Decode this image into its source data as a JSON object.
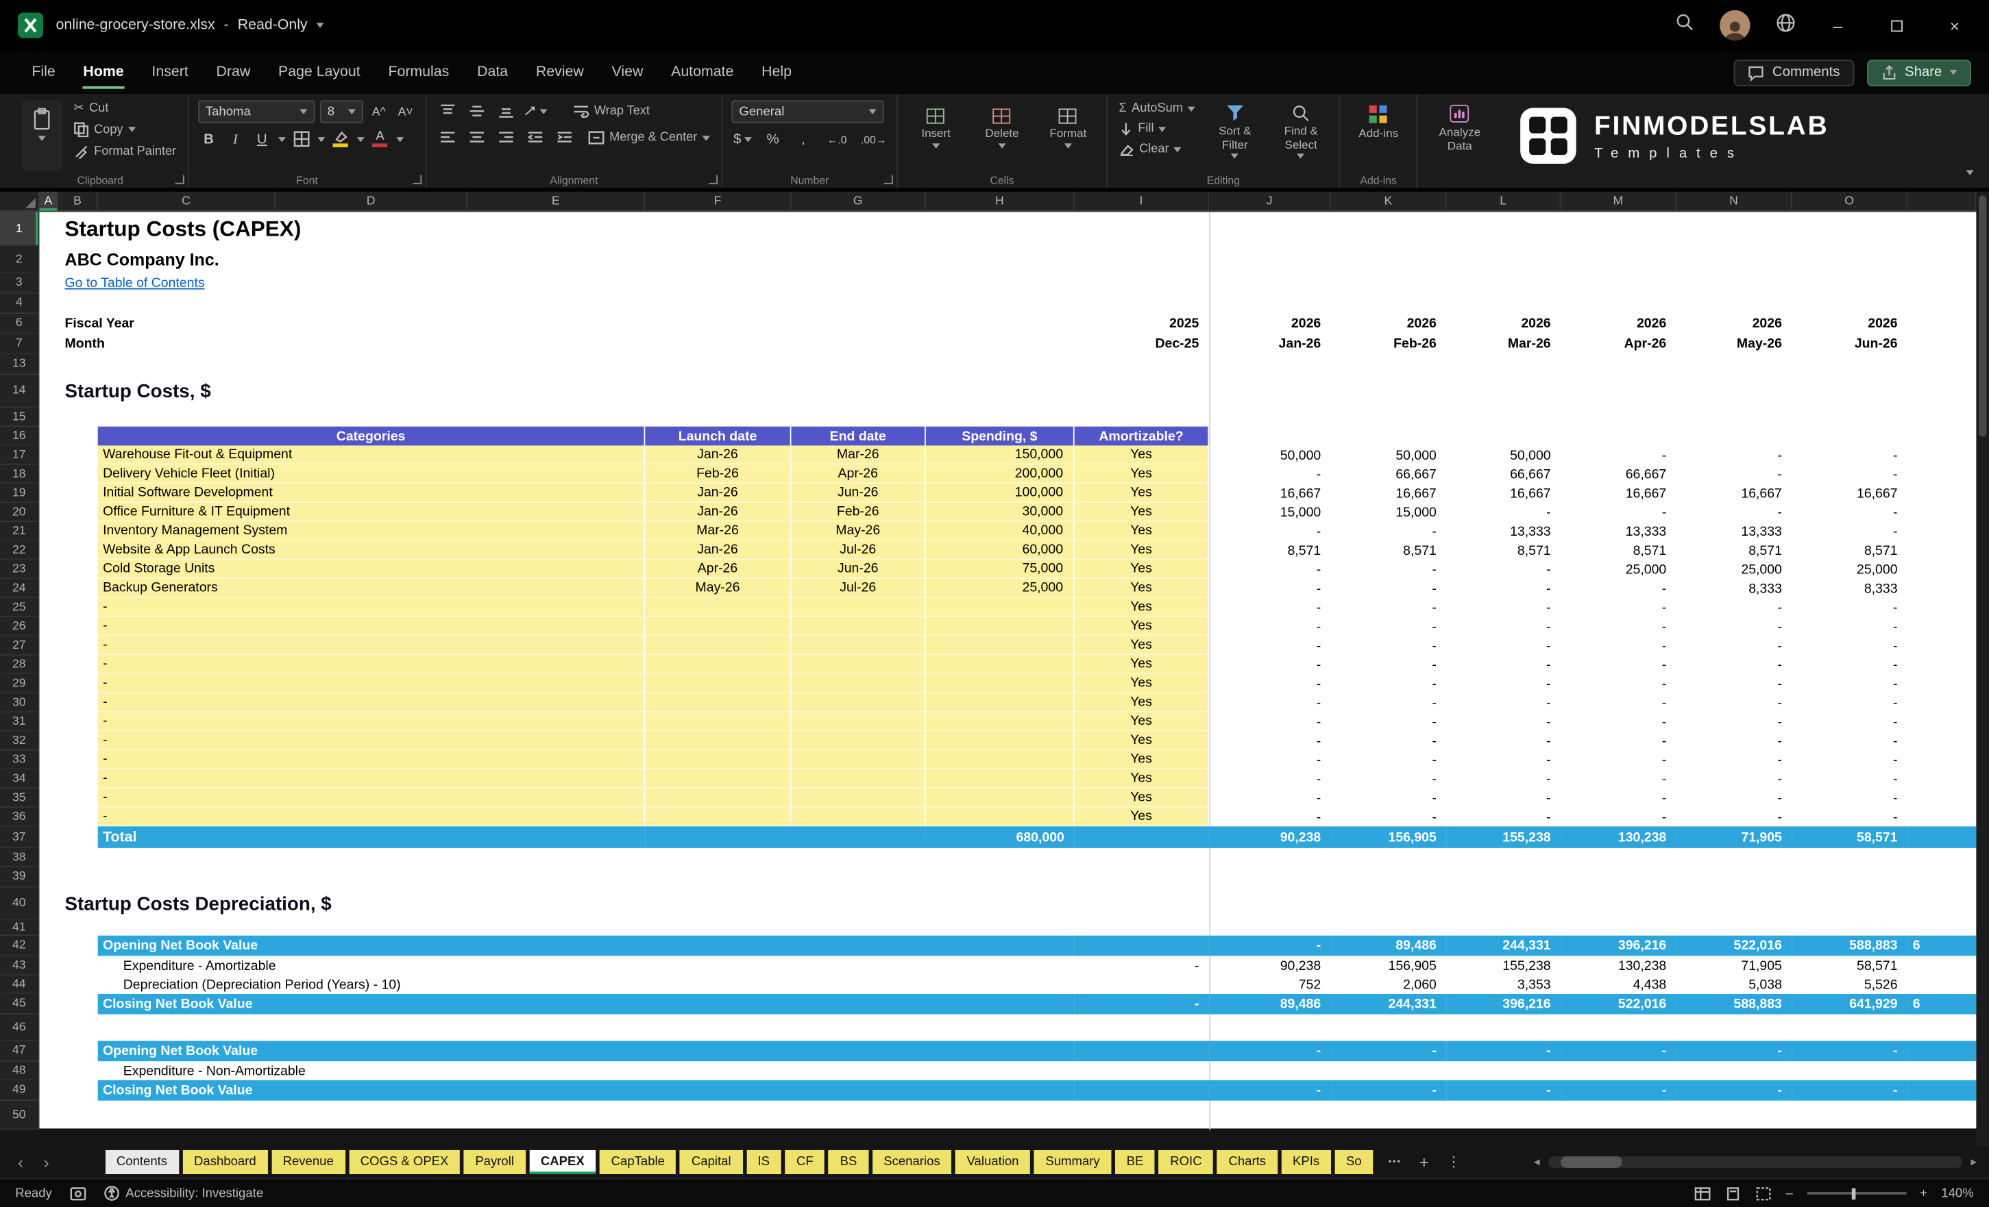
{
  "titlebar": {
    "filename": "online-grocery-store.xlsx",
    "separator": "-",
    "mode": "Read-Only",
    "window": {
      "minimize": "–",
      "close": "×"
    }
  },
  "menu": {
    "tabs": [
      "File",
      "Home",
      "Insert",
      "Draw",
      "Page Layout",
      "Formulas",
      "Data",
      "Review",
      "View",
      "Automate",
      "Help"
    ],
    "comments": "Comments",
    "share": "Share"
  },
  "ribbon": {
    "clipboard": {
      "label": "Clipboard",
      "cut": "Cut",
      "copy": "Copy",
      "format_painter": "Format Painter"
    },
    "font": {
      "label": "Font",
      "family": "Tahoma",
      "size": "8",
      "bold": "B",
      "italic": "I",
      "underline": "U",
      "grow": "A^",
      "shrink": "A˅"
    },
    "alignment": {
      "label": "Alignment",
      "wrap": "Wrap Text",
      "merge": "Merge & Center"
    },
    "number": {
      "label": "Number",
      "format": "General",
      "currency": "$",
      "percent": "%",
      "comma": ",",
      "inc_decimal": "←.0",
      "dec_decimal": ".00→"
    },
    "cells": {
      "label": "Cells",
      "insert": "Insert",
      "delete": "Delete",
      "format": "Format"
    },
    "editing": {
      "label": "Editing",
      "sigma": "Σ",
      "autosum": "AutoSum",
      "fill": "Fill",
      "clear": "Clear",
      "sort_filter": "Sort & Filter",
      "find_select": "Find & Select"
    },
    "addins": {
      "label": "Add-ins",
      "button": "Add-ins"
    },
    "analyze": {
      "label": "Analyze Data"
    },
    "brand": {
      "name": "FINMODELSLAB",
      "sub": "Templates"
    }
  },
  "grid": {
    "columns": [
      "A",
      "B",
      "C",
      "D",
      "E",
      "F",
      "G",
      "H",
      "I",
      "J",
      "K",
      "L",
      "M",
      "N",
      "O"
    ],
    "rownums": {
      "r1": "1",
      "r2": "2",
      "r3": "3",
      "r4": "4",
      "r6": "6",
      "r7": "7",
      "r13": "13",
      "r14": "14",
      "r15": "15",
      "r16": "16",
      "r37": "37",
      "r38": "38",
      "r39": "39",
      "r40": "40",
      "r41": "41",
      "r42": "42",
      "r43": "43",
      "r44": "44",
      "r45": "45",
      "r46": "46",
      "r47": "47",
      "r48": "48",
      "r49": "49",
      "r50": "50"
    }
  },
  "sheet": {
    "title": "Startup Costs (CAPEX)",
    "company": "ABC Company Inc.",
    "toc_link": "Go to Table of Contents",
    "fiscal": {
      "label": "Fiscal Year",
      "base": "2025",
      "years": [
        "2026",
        "2026",
        "2026",
        "2026",
        "2026",
        "2026"
      ]
    },
    "month": {
      "label": "Month",
      "base": "Dec-25",
      "months": [
        "Jan-26",
        "Feb-26",
        "Mar-26",
        "Apr-26",
        "May-26",
        "Jun-26"
      ]
    },
    "costs_heading": "Startup Costs, $",
    "table_headers": [
      "Categories",
      "Launch date",
      "End date",
      "Spending, $",
      "Amortizable?"
    ],
    "cost_rows": [
      {
        "n": "17",
        "category": "Warehouse Fit-out & Equipment",
        "launch": "Jan-26",
        "end": "Mar-26",
        "spend": "150,000",
        "amort": "Yes",
        "m": [
          "50,000",
          "50,000",
          "50,000",
          "-",
          "-",
          "-"
        ]
      },
      {
        "n": "18",
        "category": "Delivery Vehicle Fleet (Initial)",
        "launch": "Feb-26",
        "end": "Apr-26",
        "spend": "200,000",
        "amort": "Yes",
        "m": [
          "-",
          "66,667",
          "66,667",
          "66,667",
          "-",
          "-"
        ]
      },
      {
        "n": "19",
        "category": "Initial Software Development",
        "launch": "Jan-26",
        "end": "Jun-26",
        "spend": "100,000",
        "amort": "Yes",
        "m": [
          "16,667",
          "16,667",
          "16,667",
          "16,667",
          "16,667",
          "16,667"
        ]
      },
      {
        "n": "20",
        "category": "Office Furniture & IT Equipment",
        "launch": "Jan-26",
        "end": "Feb-26",
        "spend": "30,000",
        "amort": "Yes",
        "m": [
          "15,000",
          "15,000",
          "-",
          "-",
          "-",
          "-"
        ]
      },
      {
        "n": "21",
        "category": "Inventory Management System",
        "launch": "Mar-26",
        "end": "May-26",
        "spend": "40,000",
        "amort": "Yes",
        "m": [
          "-",
          "-",
          "13,333",
          "13,333",
          "13,333",
          "-"
        ]
      },
      {
        "n": "22",
        "category": "Website & App Launch Costs",
        "launch": "Jan-26",
        "end": "Jul-26",
        "spend": "60,000",
        "amort": "Yes",
        "m": [
          "8,571",
          "8,571",
          "8,571",
          "8,571",
          "8,571",
          "8,571"
        ]
      },
      {
        "n": "23",
        "category": "Cold Storage Units",
        "launch": "Apr-26",
        "end": "Jun-26",
        "spend": "75,000",
        "amort": "Yes",
        "m": [
          "-",
          "-",
          "-",
          "25,000",
          "25,000",
          "25,000"
        ]
      },
      {
        "n": "24",
        "category": "Backup Generators",
        "launch": "May-26",
        "end": "Jul-26",
        "spend": "25,000",
        "amort": "Yes",
        "m": [
          "-",
          "-",
          "-",
          "-",
          "8,333",
          "8,333"
        ]
      },
      {
        "n": "25",
        "category": "-",
        "launch": "",
        "end": "",
        "spend": "",
        "amort": "Yes",
        "m": [
          "-",
          "-",
          "-",
          "-",
          "-",
          "-"
        ]
      },
      {
        "n": "26",
        "category": "-",
        "launch": "",
        "end": "",
        "spend": "",
        "amort": "Yes",
        "m": [
          "-",
          "-",
          "-",
          "-",
          "-",
          "-"
        ]
      },
      {
        "n": "27",
        "category": "-",
        "launch": "",
        "end": "",
        "spend": "",
        "amort": "Yes",
        "m": [
          "-",
          "-",
          "-",
          "-",
          "-",
          "-"
        ]
      },
      {
        "n": "28",
        "category": "-",
        "launch": "",
        "end": "",
        "spend": "",
        "amort": "Yes",
        "m": [
          "-",
          "-",
          "-",
          "-",
          "-",
          "-"
        ]
      },
      {
        "n": "29",
        "category": "-",
        "launch": "",
        "end": "",
        "spend": "",
        "amort": "Yes",
        "m": [
          "-",
          "-",
          "-",
          "-",
          "-",
          "-"
        ]
      },
      {
        "n": "30",
        "category": "-",
        "launch": "",
        "end": "",
        "spend": "",
        "amort": "Yes",
        "m": [
          "-",
          "-",
          "-",
          "-",
          "-",
          "-"
        ]
      },
      {
        "n": "31",
        "category": "-",
        "launch": "",
        "end": "",
        "spend": "",
        "amort": "Yes",
        "m": [
          "-",
          "-",
          "-",
          "-",
          "-",
          "-"
        ]
      },
      {
        "n": "32",
        "category": "-",
        "launch": "",
        "end": "",
        "spend": "",
        "amort": "Yes",
        "m": [
          "-",
          "-",
          "-",
          "-",
          "-",
          "-"
        ]
      },
      {
        "n": "33",
        "category": "-",
        "launch": "",
        "end": "",
        "spend": "",
        "amort": "Yes",
        "m": [
          "-",
          "-",
          "-",
          "-",
          "-",
          "-"
        ]
      },
      {
        "n": "34",
        "category": "-",
        "launch": "",
        "end": "",
        "spend": "",
        "amort": "Yes",
        "m": [
          "-",
          "-",
          "-",
          "-",
          "-",
          "-"
        ]
      },
      {
        "n": "35",
        "category": "-",
        "launch": "",
        "end": "",
        "spend": "",
        "amort": "Yes",
        "m": [
          "-",
          "-",
          "-",
          "-",
          "-",
          "-"
        ]
      },
      {
        "n": "36",
        "category": "-",
        "launch": "",
        "end": "",
        "spend": "",
        "amort": "Yes",
        "m": [
          "-",
          "-",
          "-",
          "-",
          "-",
          "-"
        ]
      }
    ],
    "total": {
      "label": "Total",
      "spending": "680,000",
      "m": [
        "90,238",
        "156,905",
        "155,238",
        "130,238",
        "71,905",
        "58,571"
      ]
    },
    "dep_heading": "Startup Costs Depreciation, $",
    "dep_rows": [
      {
        "label": "Opening Net Book Value",
        "i": "",
        "m": [
          "-",
          "89,486",
          "244,331",
          "396,216",
          "522,016",
          "588,883"
        ],
        "ov": "6"
      },
      {
        "label": "Expenditure - Amortizable",
        "i": "-",
        "m": [
          "90,238",
          "156,905",
          "155,238",
          "130,238",
          "71,905",
          "58,571"
        ],
        "ov": ""
      },
      {
        "label": "Depreciation (Depreciation Period (Years) - 10)",
        "i": "",
        "m": [
          "752",
          "2,060",
          "3,353",
          "4,438",
          "5,038",
          "5,526"
        ],
        "ov": ""
      },
      {
        "label": "Closing Net Book Value",
        "i": "-",
        "m": [
          "89,486",
          "244,331",
          "396,216",
          "522,016",
          "588,883",
          "641,929"
        ],
        "ov": "6"
      },
      {
        "label": "Opening Net Book Value",
        "i": "",
        "m": [
          "-",
          "-",
          "-",
          "-",
          "-",
          "-"
        ],
        "ov": ""
      },
      {
        "label": "Expenditure - Non-Amortizable",
        "i": "",
        "m": [
          "",
          "",
          "",
          "",
          "",
          ""
        ],
        "ov": ""
      },
      {
        "label": "Closing Net Book Value",
        "i": "",
        "m": [
          "-",
          "-",
          "-",
          "-",
          "-",
          "-"
        ],
        "ov": ""
      }
    ]
  },
  "sheettabs": {
    "items": [
      "Contents",
      "Dashboard",
      "Revenue",
      "COGS & OPEX",
      "Payroll",
      "CAPEX",
      "CapTable",
      "Capital",
      "IS",
      "CF",
      "BS",
      "Scenarios",
      "Valuation",
      "Summary",
      "BE",
      "ROIC",
      "Charts",
      "KPIs",
      "So"
    ],
    "active": "CAPEX",
    "nav": {
      "left": "‹",
      "right": "›",
      "more": "•••",
      "add": "+",
      "options": "⋮",
      "scroll_left": "◄",
      "scroll_right": "►"
    }
  },
  "status": {
    "ready": "Ready",
    "accessibility": "Accessibility: Investigate",
    "zoom": "140%"
  }
}
